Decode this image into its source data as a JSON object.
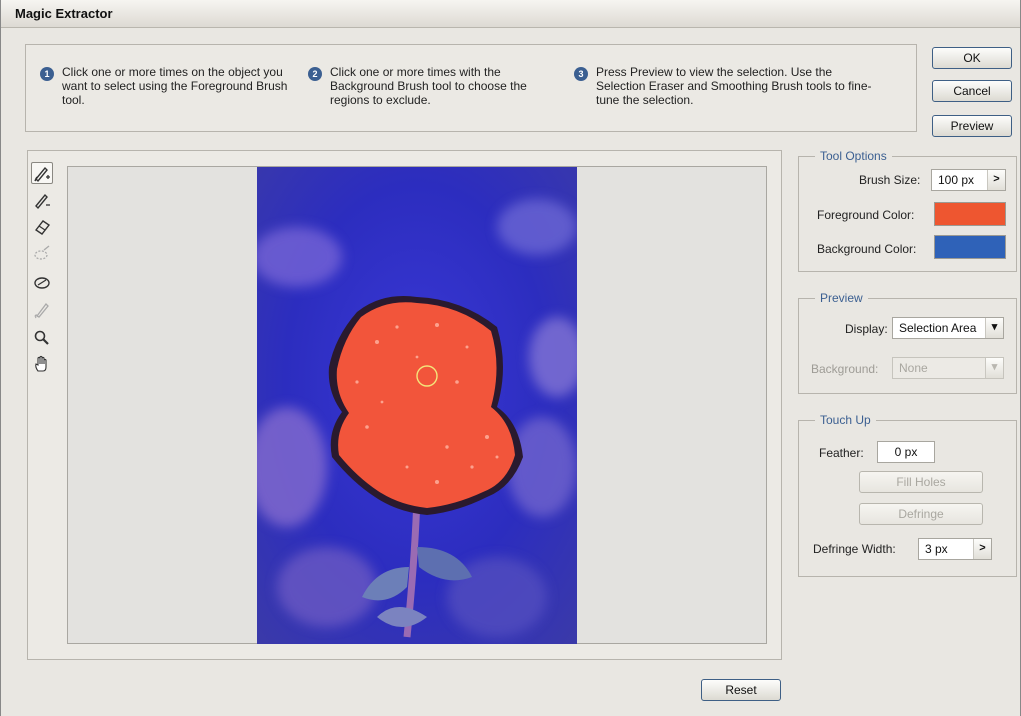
{
  "window": {
    "title": "Magic Extractor"
  },
  "instructions": [
    {
      "num": "1",
      "text": "Click one or more times on the object you want to select using the Foreground Brush tool."
    },
    {
      "num": "2",
      "text": "Click one or more times with the Background Brush tool to choose the regions to exclude."
    },
    {
      "num": "3",
      "text": "Press Preview to view the selection. Use the Selection Eraser and Smoothing Brush tools to fine-tune the selection."
    }
  ],
  "buttons": {
    "ok": "OK",
    "cancel": "Cancel",
    "preview": "Preview",
    "reset": "Reset"
  },
  "tools": [
    {
      "name": "foreground-brush-icon",
      "glyph": "✍",
      "active": true,
      "enabled": true
    },
    {
      "name": "background-brush-icon",
      "glyph": "✎",
      "active": false,
      "enabled": true
    },
    {
      "name": "point-eraser-icon",
      "glyph": "⌫",
      "active": false,
      "enabled": true
    },
    {
      "name": "add-to-selection-icon",
      "glyph": "◌",
      "active": false,
      "enabled": false
    },
    {
      "name": "remove-from-selection-icon",
      "glyph": "⊘",
      "active": false,
      "enabled": true
    },
    {
      "name": "smoothing-brush-icon",
      "glyph": "✐",
      "active": false,
      "enabled": false
    },
    {
      "name": "zoom-icon",
      "glyph": "🔍",
      "active": false,
      "enabled": true
    },
    {
      "name": "hand-icon",
      "glyph": "✋",
      "active": false,
      "enabled": true
    }
  ],
  "tool_options": {
    "legend": "Tool Options",
    "brush_size_label": "Brush Size:",
    "brush_size_value": "100 px",
    "foreground_label": "Foreground Color:",
    "background_label": "Background Color:",
    "foreground_color": "#ee5630",
    "background_color": "#2f62b8"
  },
  "preview": {
    "legend": "Preview",
    "display_label": "Display:",
    "display_value": "Selection Area",
    "background_label": "Background:",
    "background_value": "None"
  },
  "touch_up": {
    "legend": "Touch Up",
    "feather_label": "Feather:",
    "feather_value": "0 px",
    "fill_holes": "Fill Holes",
    "defringe": "Defringe",
    "defringe_width_label": "Defringe Width:",
    "defringe_width_value": "3 px"
  },
  "colors": {
    "accent": "#3b5f91",
    "photo_bg": "#2d2fc6",
    "selection": "#f2553b"
  }
}
